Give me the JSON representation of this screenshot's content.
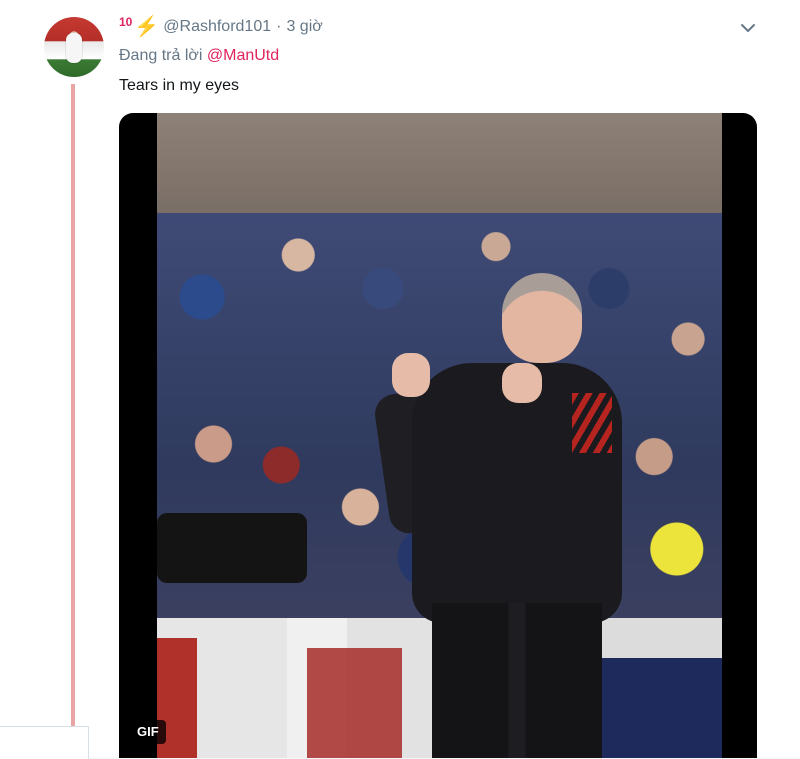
{
  "tweet": {
    "badge": "10",
    "badge_icon": "lightning-bolt-emoji",
    "handle": "@Rashford101",
    "separator": "·",
    "time": "3 giờ",
    "replying_prefix": "Đang trả lời",
    "replying_to": "@ManUtd",
    "text": "Tears in my eyes",
    "media": {
      "badge": "GIF"
    }
  },
  "colors": {
    "accent": "#e0245e",
    "secondary_text": "#657786",
    "thread_line": "#e8a5a3"
  }
}
